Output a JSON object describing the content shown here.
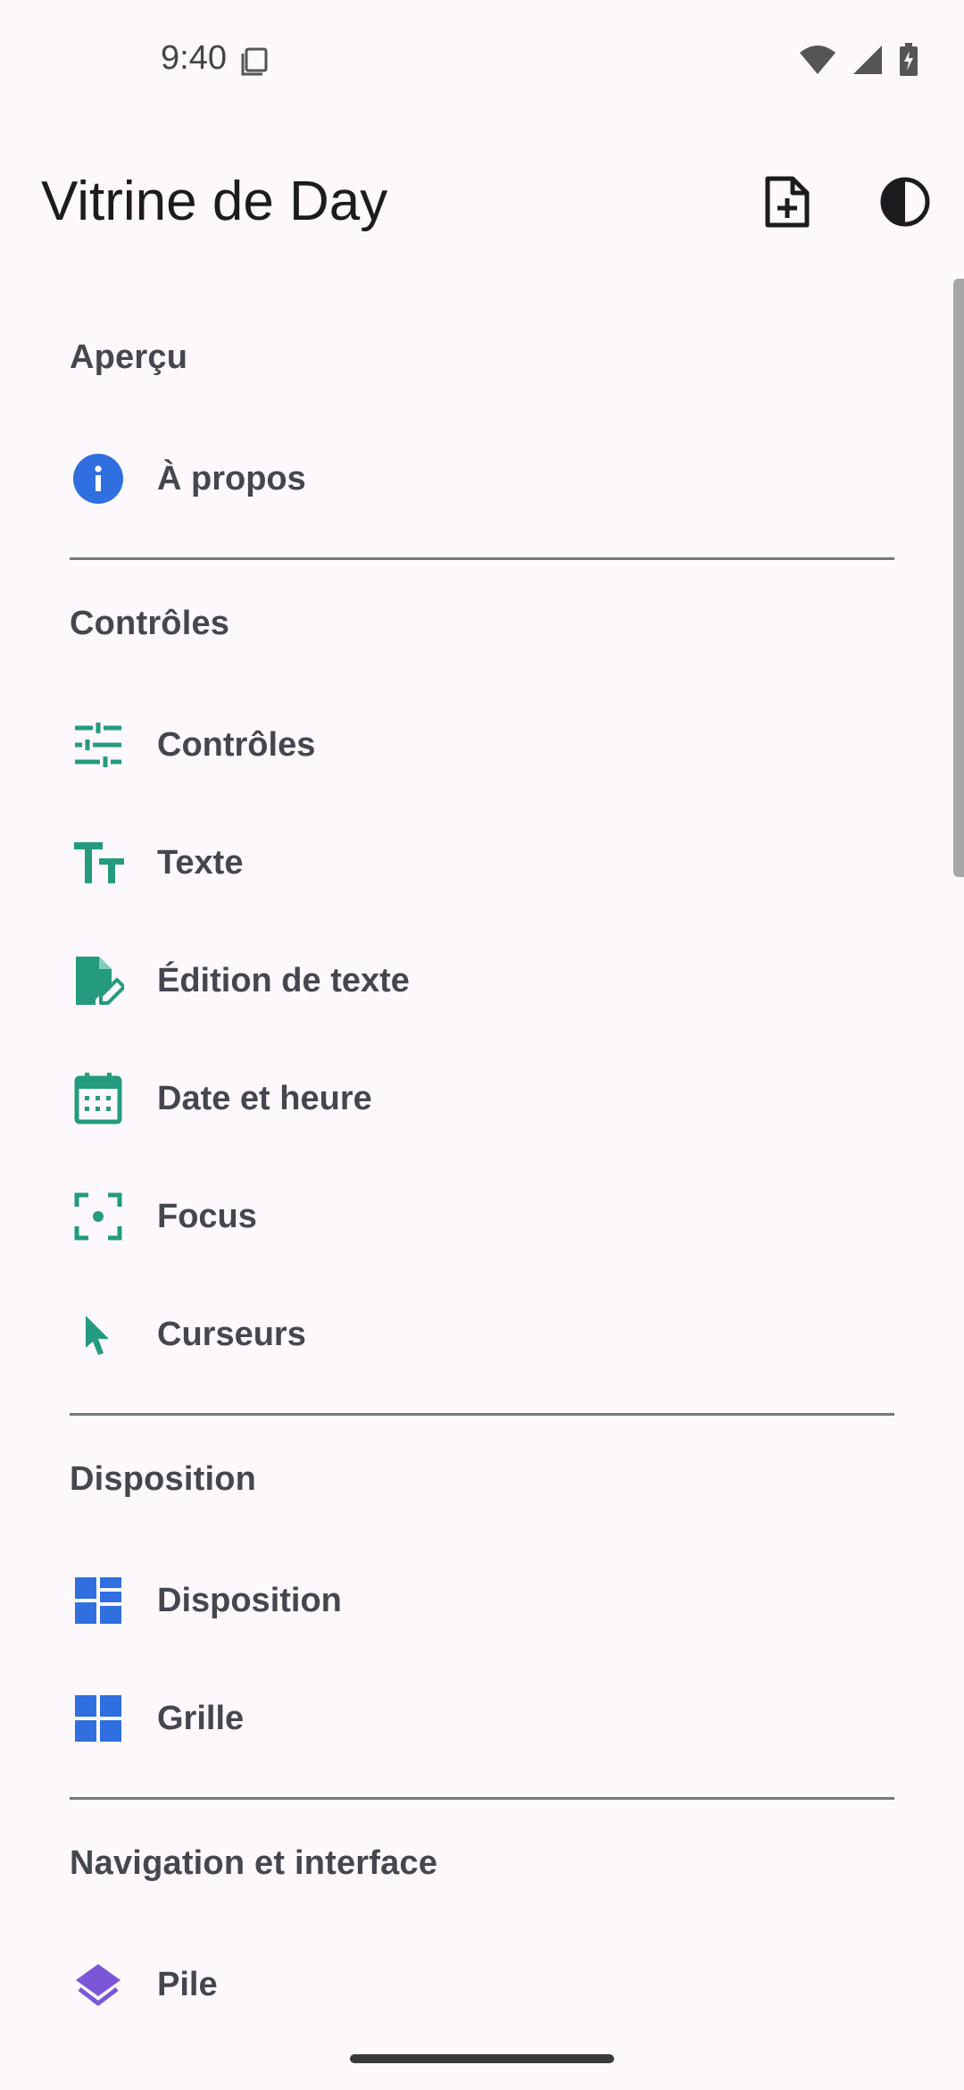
{
  "status_bar": {
    "time": "9:40",
    "icons": [
      "sim-card-icon",
      "wifi-icon",
      "cellular-signal-icon",
      "battery-charging-icon"
    ]
  },
  "app_bar": {
    "title": "Vitrine de Day",
    "actions": [
      "new-document-icon",
      "contrast-theme-icon"
    ]
  },
  "sections": [
    {
      "header": "Aperçu",
      "items": [
        {
          "label": "À propos",
          "icon": "info-icon",
          "color": "#2f6fdf"
        }
      ]
    },
    {
      "header": "Contrôles",
      "items": [
        {
          "label": "Contrôles",
          "icon": "tune-icon",
          "color": "#249b7e"
        },
        {
          "label": "Texte",
          "icon": "text-fields-icon",
          "color": "#249b7e"
        },
        {
          "label": "Édition de texte",
          "icon": "edit-document-icon",
          "color": "#249b7e"
        },
        {
          "label": "Date et heure",
          "icon": "calendar-icon",
          "color": "#249b7e"
        },
        {
          "label": "Focus",
          "icon": "center-focus-icon",
          "color": "#249b7e"
        },
        {
          "label": "Curseurs",
          "icon": "cursor-arrow-icon",
          "color": "#249b7e"
        }
      ]
    },
    {
      "header": "Disposition",
      "items": [
        {
          "label": "Disposition",
          "icon": "dashboard-layout-icon",
          "color": "#2f6fdf"
        },
        {
          "label": "Grille",
          "icon": "grid-icon",
          "color": "#2f6fdf"
        }
      ]
    },
    {
      "header": "Navigation et interface",
      "items": [
        {
          "label": "Pile",
          "icon": "layers-stack-icon",
          "color": "#7b57d8"
        }
      ]
    }
  ]
}
